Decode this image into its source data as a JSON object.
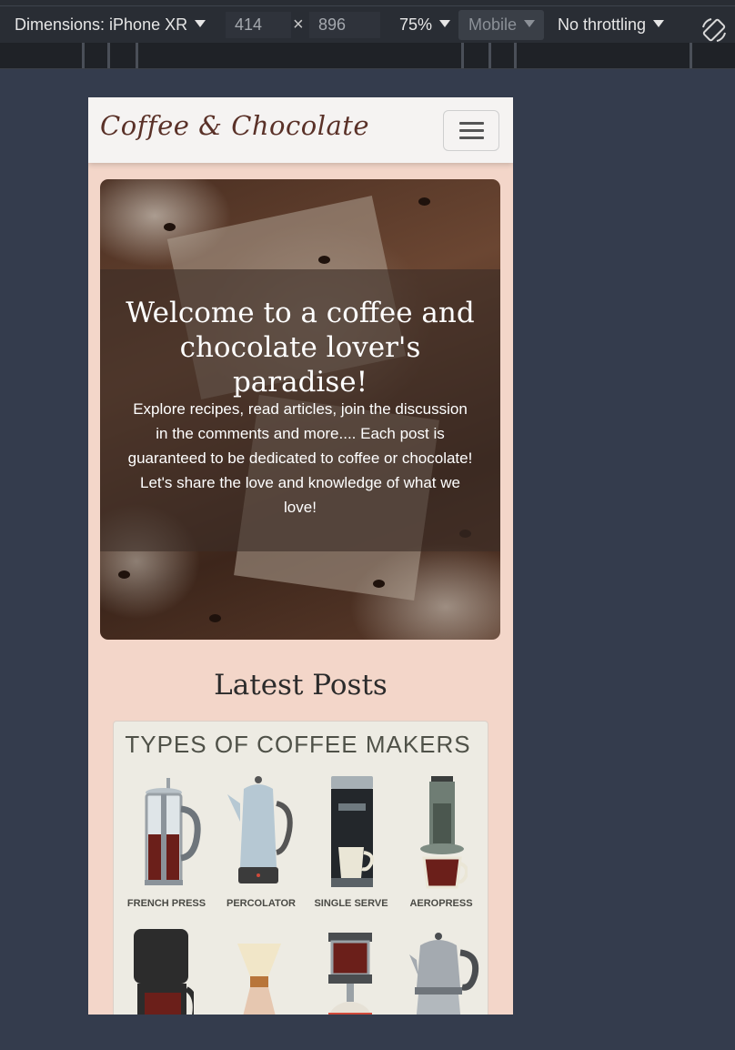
{
  "devtools": {
    "dimensions_label": "Dimensions: iPhone XR",
    "width_value": "414",
    "times_symbol": "×",
    "height_value": "896",
    "zoom": "75%",
    "mode": "Mobile",
    "throttling": "No throttling",
    "rotate_icon": "rotate-icon"
  },
  "site": {
    "brand": "Coffee & Chocolate",
    "menu_icon": "hamburger-menu-icon"
  },
  "hero": {
    "title": "Welcome to a coffee and chocolate lover's paradise!",
    "text": "Explore recipes, read articles, join the discussion in the comments and more.... Each post is guaranteed to be dedicated to coffee or chocolate! Let's share the love and knowledge of what we love!"
  },
  "latest": {
    "heading": "Latest Posts",
    "post_image_title": "TYPES OF COFFEE MAKERS",
    "makers": [
      "FRENCH PRESS",
      "PERCOLATOR",
      "SINGLE SERVE",
      "AEROPRESS"
    ]
  },
  "colors": {
    "page_bg": "#f3d6c9",
    "navbar_bg": "#f5f3f2",
    "brand_color": "#5a3128",
    "devtools_bg": "#292d34"
  }
}
